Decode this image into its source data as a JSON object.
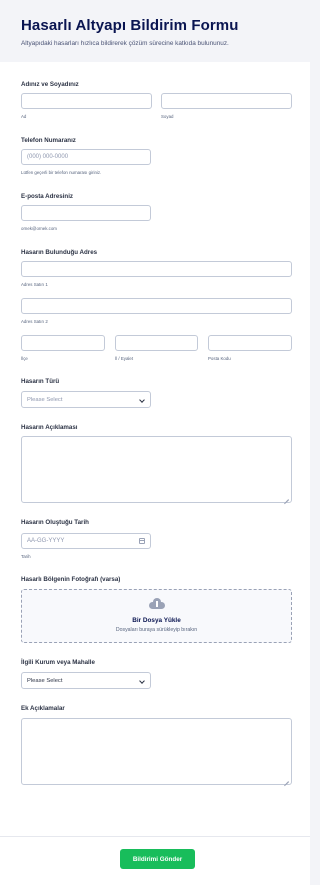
{
  "header": {
    "title": "Hasarlı Altyapı Bildirim Formu",
    "subtitle": "Altyapıdaki hasarları hızlıca bildirerek çözüm sürecine katkıda bulununuz."
  },
  "name": {
    "label": "Adınız ve Soyadınız",
    "first_sub": "Ad",
    "last_sub": "Soyad"
  },
  "phone": {
    "label": "Telefon Numaranız",
    "placeholder": "(000) 000-0000",
    "hint": "Lütfen geçerli bir telefon numarası giriniz."
  },
  "email": {
    "label": "E-posta Adresiniz",
    "hint": "ornek@ornek.com"
  },
  "address": {
    "label": "Hasarın Bulunduğu Adres",
    "line1_sub": "Adres Satırı 1",
    "line2_sub": "Adres Satırı 2",
    "city_sub": "İlçe",
    "state_sub": "İl / Eyalet",
    "zip_sub": "Posta Kodu"
  },
  "damage_type": {
    "label": "Hasarın Türü",
    "selected": "Please Select"
  },
  "description": {
    "label": "Hasarın Açıklaması"
  },
  "date": {
    "label": "Hasarın Oluştuğu Tarih",
    "placeholder": "AA-GG-YYYY",
    "hint": "Tarih"
  },
  "photo": {
    "label": "Hasarlı Bölgenin Fotoğrafı (varsa)",
    "upload_title": "Bir Dosya Yükle",
    "upload_hint": "Dosyaları buraya sürükleyip bırakın"
  },
  "institution": {
    "label": "İlgili Kurum veya Mahalle",
    "selected": "Please Select"
  },
  "notes": {
    "label": "Ek Açıklamalar"
  },
  "submit": {
    "label": "Bildirimi Gönder"
  },
  "colors": {
    "accent_green": "#18bd5b",
    "title_navy": "#0a1551",
    "header_bg": "#f3f4f8"
  }
}
